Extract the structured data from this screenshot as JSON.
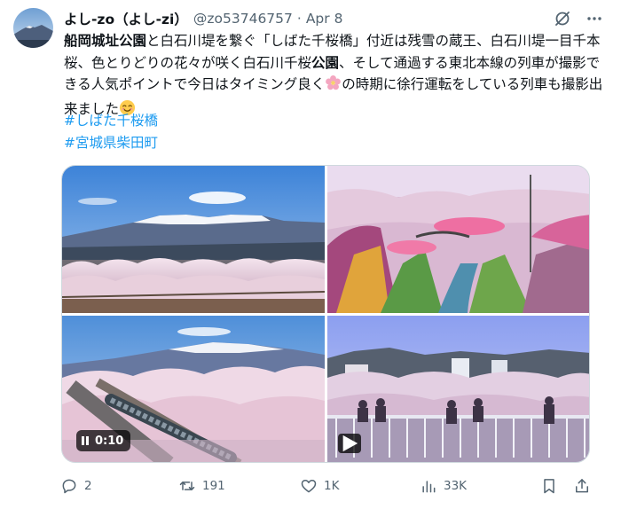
{
  "colors": {
    "link": "#1d9bf0",
    "muted": "#536471",
    "text": "#0f1419",
    "border": "#cfd9de"
  },
  "author": {
    "display_name": "よし-zo（よし-zi）",
    "handle": "@zo53746757",
    "separator": "·",
    "date": "Apr 8"
  },
  "header_icons": [
    "grok-icon",
    "more-icon"
  ],
  "tweet": {
    "text": [
      {
        "bold": true,
        "text": "船岡城址公園"
      },
      {
        "bold": false,
        "text": "と白石川堤を繋ぐ「しばた千桜橋」付近は残雪の蔵王、白石川堤一目千本桜、色とりどりの花々が咲く白石川千桜"
      },
      {
        "bold": true,
        "text": "公園"
      },
      {
        "bold": false,
        "text": "、そして通過する東北本線の列車が撮影できる人気ポイントで今日はタイミング良く"
      },
      {
        "emoji": "cherry-blossom-icon"
      },
      {
        "bold": false,
        "text": "の時期に徐行運転をしている列車も撮影出来ました"
      },
      {
        "emoji": "smile-icon"
      }
    ],
    "hashtags": [
      "#しばた千桜橋",
      "#宮城県柴田町"
    ]
  },
  "media": {
    "items": [
      {
        "name": "photo-zao-cherry-blossoms",
        "kind": "photo"
      },
      {
        "name": "photo-flower-park-bridge",
        "kind": "photo"
      },
      {
        "name": "video-train-cherry-blossoms",
        "kind": "video",
        "duration": "0:10"
      },
      {
        "name": "video-bridge-crowd",
        "kind": "video"
      }
    ]
  },
  "actions": {
    "reply": "2",
    "retweet": "191",
    "like": "1K",
    "views": "33K"
  }
}
